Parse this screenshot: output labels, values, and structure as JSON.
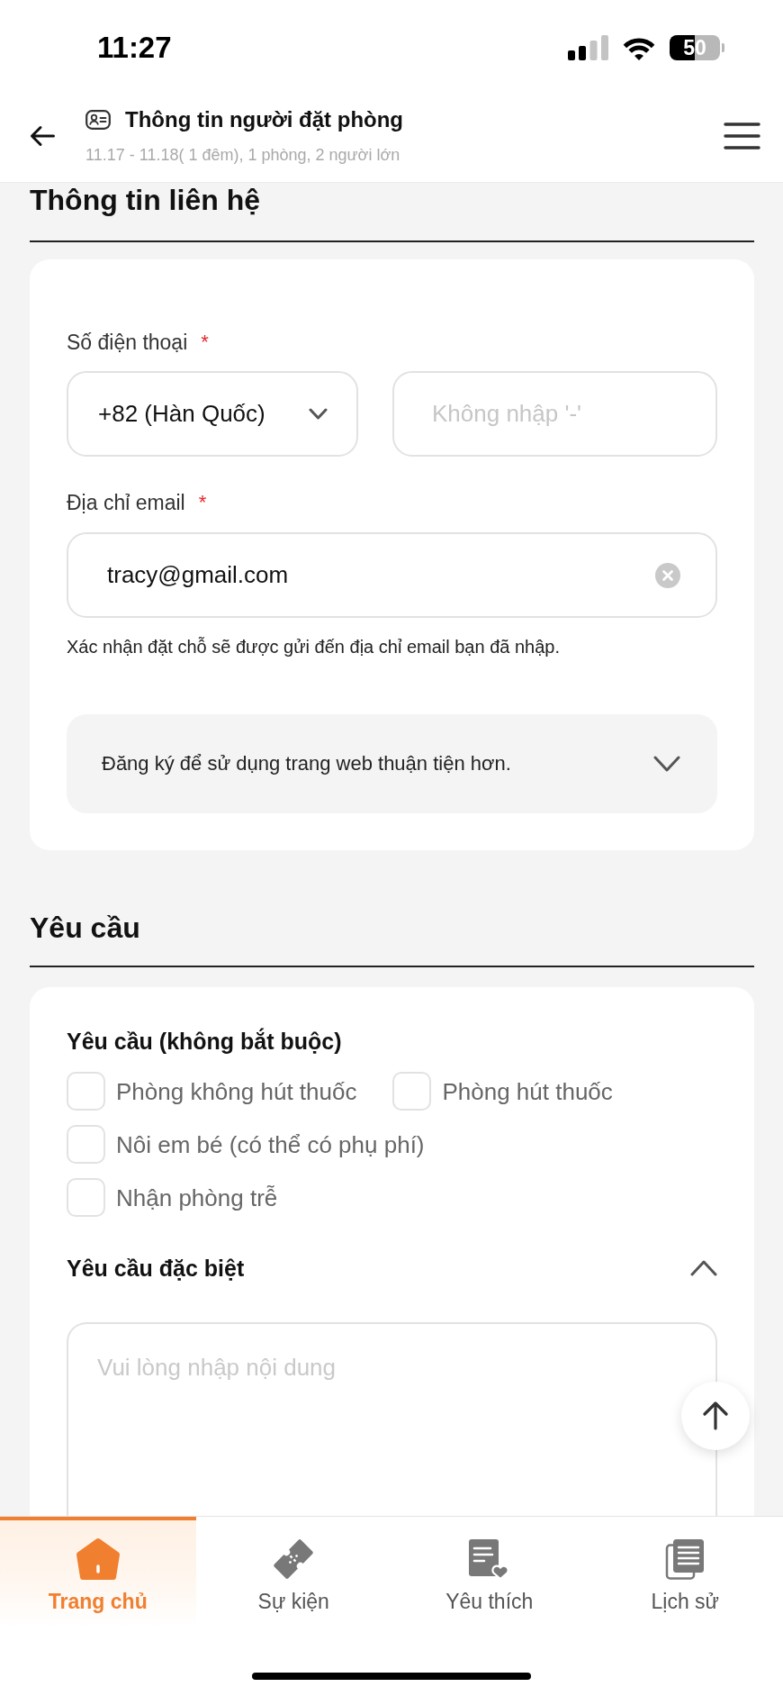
{
  "status_bar": {
    "time": "11:27",
    "battery": "50"
  },
  "header": {
    "title": "Thông tin người đặt phòng",
    "subtitle": "11.17 - 11.18( 1 đêm), 1 phòng, 2 người lớn"
  },
  "contact_section": {
    "heading": "Thông tin liên hệ",
    "phone": {
      "label": "Số điện thoại",
      "required_mark": "*",
      "country_code": "+82 (Hàn Quốc)",
      "placeholder": "Không nhập '-'"
    },
    "email": {
      "label": "Địa chỉ email",
      "required_mark": "*",
      "value": "tracy@gmail.com",
      "note": "Xác nhận đặt chỗ sẽ được gửi đến địa chỉ email bạn đã nhập."
    },
    "signup": {
      "label": "Đăng ký để sử dụng trang web thuận tiện hơn.",
      "expanded": false
    }
  },
  "requests_section": {
    "heading": "Yêu cầu",
    "options_title": "Yêu cầu (không bắt buộc)",
    "option_rows": [
      {
        "options": [
          {
            "label": "Phòng không hút thuốc",
            "checked": false
          },
          {
            "label": "Phòng hút thuốc",
            "checked": false
          }
        ]
      },
      {
        "options": [
          {
            "label": "Nôi em bé (có thể có phụ phí)",
            "checked": false
          }
        ]
      },
      {
        "options": [
          {
            "label": "Nhận phòng trễ",
            "checked": false
          }
        ]
      }
    ],
    "special_request": {
      "title": "Yêu cầu đặc biệt",
      "expanded": true,
      "placeholder": "Vui lòng nhập nội dung"
    }
  },
  "bottom_nav": [
    {
      "label": "Trang chủ",
      "selected": true
    },
    {
      "label": "Sự kiện",
      "selected": false
    },
    {
      "label": "Yêu thích",
      "selected": false
    },
    {
      "label": "Lịch sử",
      "selected": false
    }
  ]
}
